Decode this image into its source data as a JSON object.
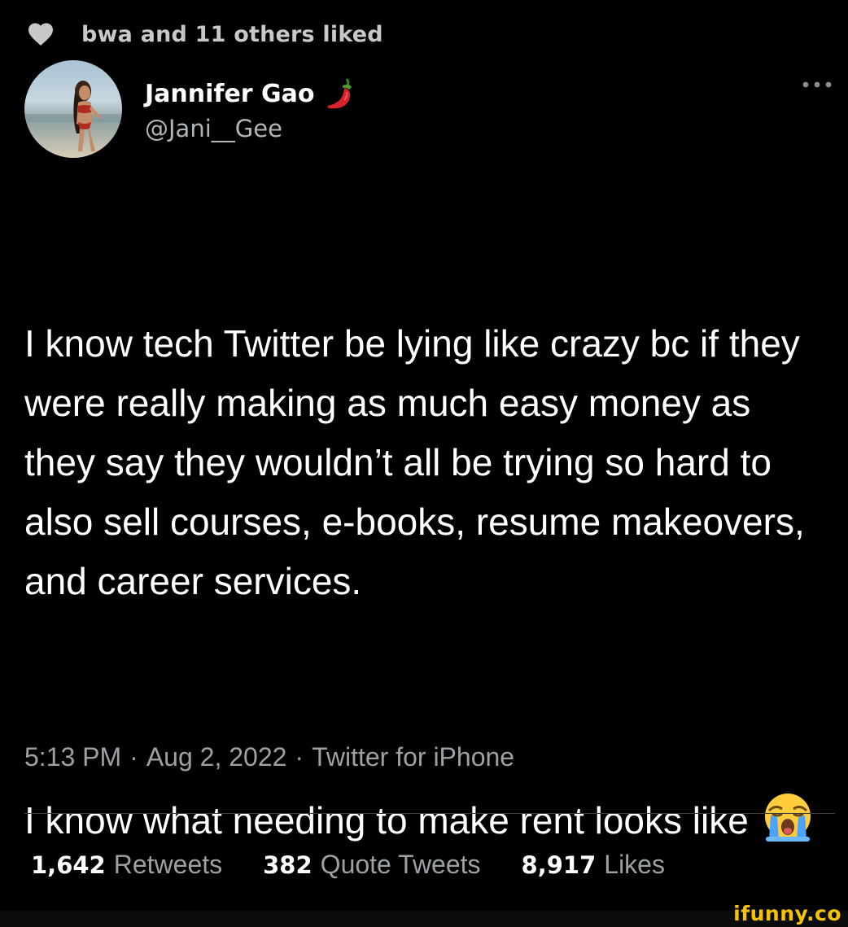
{
  "social_context": {
    "text": "bwa and 11 others liked",
    "icon": "heart-icon"
  },
  "author": {
    "display_name": "Jannifer Gao",
    "handle": "@Jani__Gee",
    "name_emoji": "chili-pepper-icon",
    "avatar": "avatar"
  },
  "tweet": {
    "paragraph_1": "I know tech Twitter be lying like crazy bc if they were really making as much easy money as they say they wouldn’t all be trying so hard to also sell courses, e-books, resume makeovers, and career services.",
    "paragraph_2_text": "I know what needing to make rent looks like",
    "paragraph_2_emoji": "loudly-crying-face-icon"
  },
  "meta": {
    "time": "5:13 PM",
    "separator": "·",
    "date": "Aug 2, 2022",
    "source": "Twitter for iPhone"
  },
  "stats": {
    "retweets_count": "1,642",
    "retweets_label": "Retweets",
    "quotes_count": "382",
    "quotes_label": "Quote Tweets",
    "likes_count": "8,917",
    "likes_label": "Likes"
  },
  "watermark": {
    "text": "ifunny.co"
  },
  "colors": {
    "background": "#000000",
    "primary_text": "#ffffff",
    "secondary_text": "#9ca1a5",
    "chili": "#d8232a",
    "watermark": "#f7c200"
  }
}
